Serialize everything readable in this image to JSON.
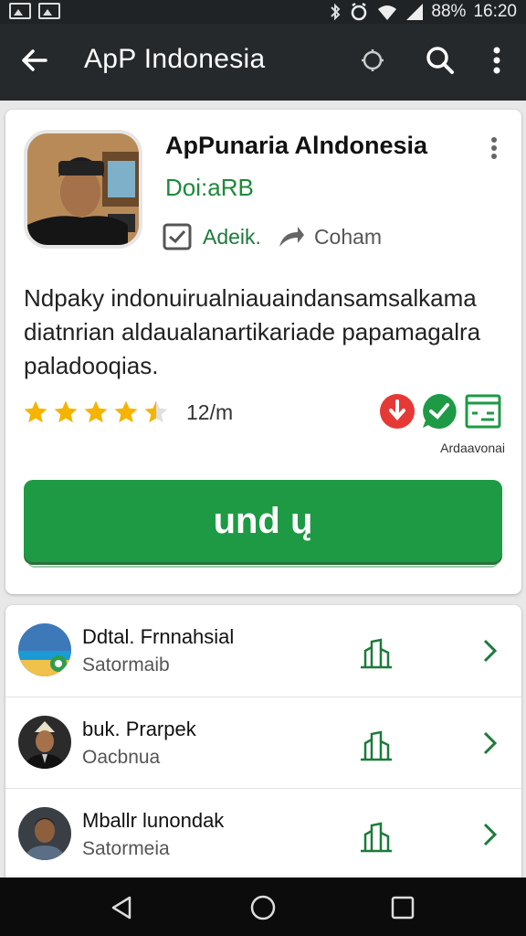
{
  "status_bar": {
    "battery": "88%",
    "time": "16:20",
    "icons": [
      "image-icon",
      "gallery-icon",
      "bluetooth-icon",
      "alarm-icon",
      "wifi-icon",
      "signal-icon"
    ]
  },
  "app_bar": {
    "title": "ApP Indonesia",
    "icons": [
      "back-arrow-icon",
      "settings-icon",
      "search-icon",
      "more-vert-icon"
    ]
  },
  "app_card": {
    "title": "ApPunaria Alndonesia",
    "developer": "Doi:aRB",
    "meta_tag": "Adeik.",
    "meta_share": "Coham",
    "description": "Ndpaky indonuirualniauaindansamsalkama diatnrian aldaualanartikariade papamagalra paladooqias.",
    "rating": {
      "value": 4.5,
      "max": 5,
      "count": "12/m"
    },
    "badges": {
      "label": "Ardaavonai",
      "icons": [
        "download-badge-icon",
        "chat-badge-icon",
        "window-badge-icon"
      ]
    },
    "install_label": "und ų",
    "colors": {
      "accent": "#1e9a45",
      "developer": "#1d8a3a",
      "star": "#f4b400",
      "badge_red": "#e53935"
    }
  },
  "list": [
    {
      "title": "Ddtal. Frnnahsial",
      "subtitle": "Satormaib"
    },
    {
      "title": "buk. Prarpek",
      "subtitle": "Oacbnua"
    },
    {
      "title": "Mballr lunondak",
      "subtitle": "Satormeia"
    }
  ],
  "nav_bar": {
    "icons": [
      "back-triangle-icon",
      "home-circle-icon",
      "recents-square-icon"
    ]
  }
}
